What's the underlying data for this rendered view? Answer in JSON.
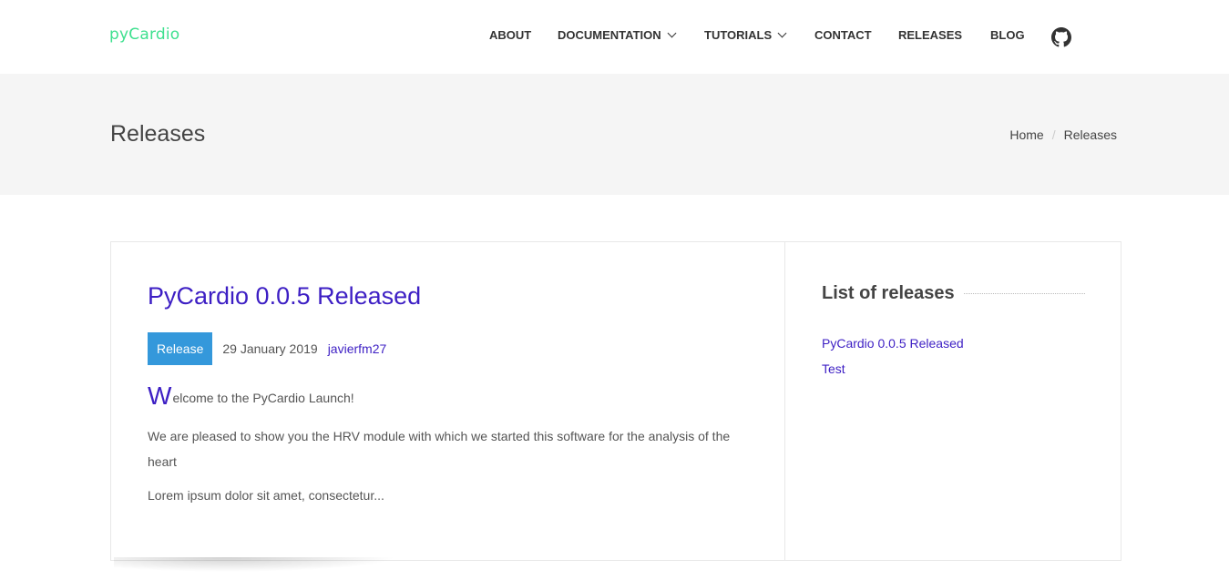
{
  "header": {
    "logo": "pyCardio",
    "nav": [
      {
        "label": "ABOUT"
      },
      {
        "label": "DOCUMENTATION"
      },
      {
        "label": "TUTORIALS"
      },
      {
        "label": "CONTACT"
      },
      {
        "label": "RELEASES"
      },
      {
        "label": "BLOG"
      }
    ]
  },
  "band": {
    "title": "Releases",
    "breadcrumb": [
      "Home",
      "Releases"
    ]
  },
  "post": {
    "title": "PyCardio 0.0.5 Released",
    "tag": "Release",
    "date": "29 January 2019",
    "author": "javierfm27",
    "dropcap": "W",
    "first_paragraph_rest": "elcome to the PyCardio Launch!",
    "second_paragraph": "We are pleased to show you the HRV module with which we started this software for the analysis of the heart",
    "third_paragraph": "Lorem ipsum dolor sit amet, consectetur..."
  },
  "sidebar": {
    "title": "List of releases",
    "items": [
      "PyCardio 0.0.5 Released",
      "Test"
    ]
  },
  "colors": {
    "logo": "#3ee08f",
    "link": "#3d1fc4",
    "tag_bg": "#3498db",
    "band_bg": "#f5f5f5"
  },
  "icons": {
    "github": "github-icon",
    "chevron": "chevron-down-icon"
  }
}
